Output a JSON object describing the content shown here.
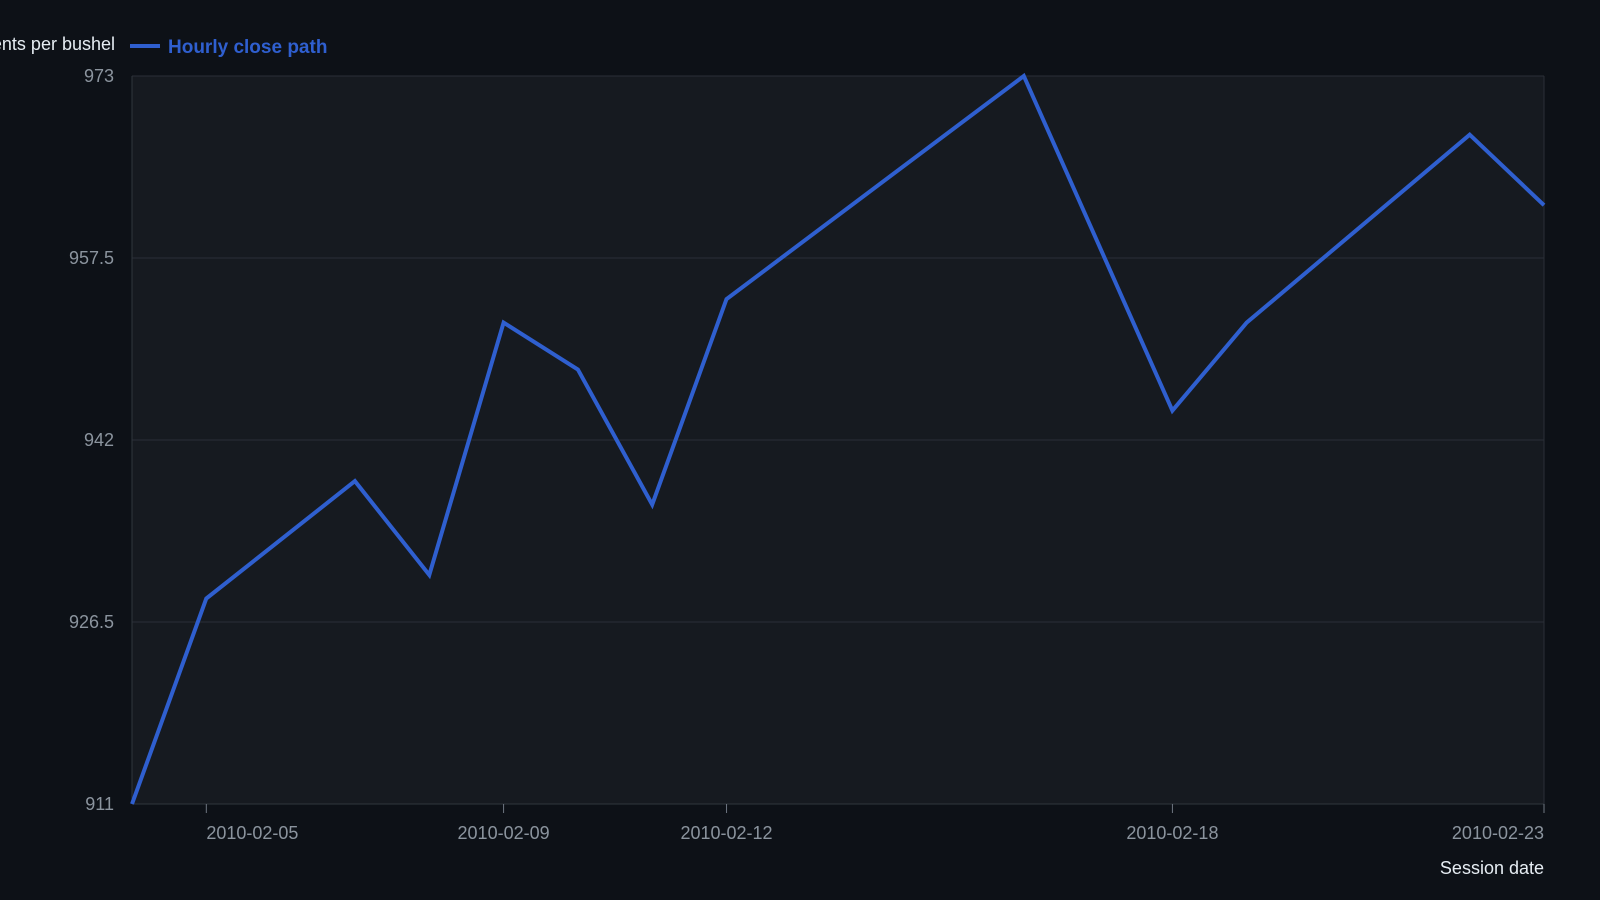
{
  "chart_data": {
    "type": "line",
    "xlabel": "Session date",
    "ylabel": "Cents per bushel",
    "ylim": [
      911,
      973
    ],
    "y_ticks": [
      "911",
      "926.5",
      "942",
      "957.5",
      "973"
    ],
    "x_ticks": [
      "2010-02-05",
      "2010-02-09",
      "2010-02-12",
      "2010-02-18",
      "2010-02-23"
    ],
    "grid": true,
    "legend_position": "top-left",
    "colors": {
      "background": "#0d1117",
      "plot_bg": "#161a20",
      "series": "#2f5fcf"
    },
    "series": [
      {
        "name": "Hourly close path",
        "x": [
          "2010-02-04",
          "2010-02-05",
          "2010-02-07",
          "2010-02-08",
          "2010-02-09",
          "2010-02-10",
          "2010-02-11",
          "2010-02-12",
          "2010-02-16",
          "2010-02-18",
          "2010-02-19",
          "2010-02-22",
          "2010-02-23"
        ],
        "values": [
          911,
          928.5,
          938.5,
          930.5,
          952,
          948,
          936.5,
          954,
          973,
          944.5,
          952,
          968,
          962
        ]
      }
    ]
  }
}
